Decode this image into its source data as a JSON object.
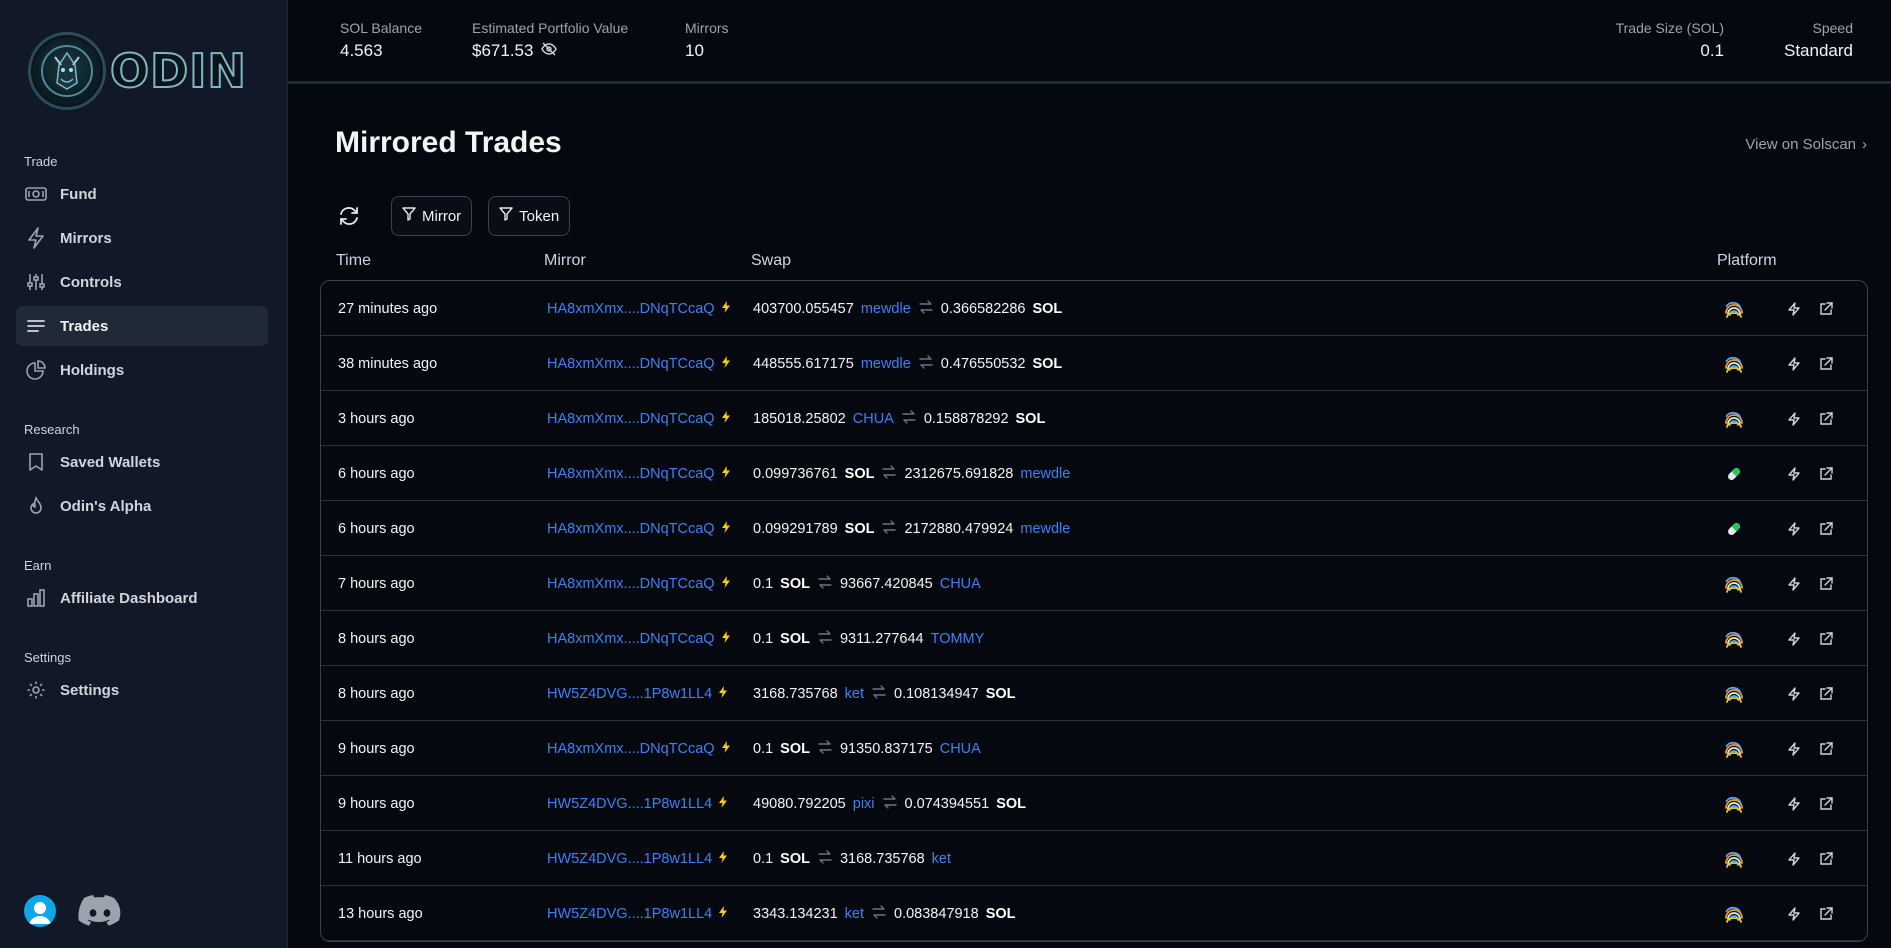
{
  "sidebar": {
    "brand": "ODIN",
    "sections": {
      "trade": "Trade",
      "research": "Research",
      "earn": "Earn",
      "settings": "Settings"
    },
    "items": {
      "fund": "Fund",
      "mirrors": "Mirrors",
      "controls": "Controls",
      "trades": "Trades",
      "holdings": "Holdings",
      "saved_wallets": "Saved Wallets",
      "odins_alpha": "Odin's Alpha",
      "affiliate_dashboard": "Affiliate Dashboard",
      "settings": "Settings"
    },
    "active_item": "trades"
  },
  "header": {
    "sol_balance_label": "SOL Balance",
    "sol_balance": "4.563",
    "portfolio_label": "Estimated Portfolio Value",
    "portfolio_value": "$671.53",
    "mirrors_label": "Mirrors",
    "mirrors_value": "10",
    "trade_size_label": "Trade Size (SOL)",
    "trade_size_value": "0.1",
    "speed_label": "Speed",
    "speed_value": "Standard"
  },
  "main": {
    "title": "Mirrored Trades",
    "view_link": "View on Solscan",
    "filters": {
      "mirror": "Mirror",
      "token": "Token"
    },
    "columns": {
      "time": "Time",
      "mirror": "Mirror",
      "swap": "Swap",
      "platform": "Platform"
    },
    "rows": [
      {
        "time": "27 minutes ago",
        "mirror": "HA8xmXmx....DNqTCcaQ",
        "in_amt": "403700.055457",
        "in_tok": "mewdle",
        "out_amt": "0.366582286",
        "out_tok": "SOL",
        "platform": "rainbow"
      },
      {
        "time": "38 minutes ago",
        "mirror": "HA8xmXmx....DNqTCcaQ",
        "in_amt": "448555.617175",
        "in_tok": "mewdle",
        "out_amt": "0.476550532",
        "out_tok": "SOL",
        "platform": "rainbow"
      },
      {
        "time": "3 hours ago",
        "mirror": "HA8xmXmx....DNqTCcaQ",
        "in_amt": "185018.25802",
        "in_tok": "CHUA",
        "out_amt": "0.158878292",
        "out_tok": "SOL",
        "platform": "rainbow"
      },
      {
        "time": "6 hours ago",
        "mirror": "HA8xmXmx....DNqTCcaQ",
        "in_amt": "0.099736761",
        "in_tok": "SOL",
        "out_amt": "2312675.691828",
        "out_tok": "mewdle",
        "platform": "pill"
      },
      {
        "time": "6 hours ago",
        "mirror": "HA8xmXmx....DNqTCcaQ",
        "in_amt": "0.099291789",
        "in_tok": "SOL",
        "out_amt": "2172880.479924",
        "out_tok": "mewdle",
        "platform": "pill"
      },
      {
        "time": "7 hours ago",
        "mirror": "HA8xmXmx....DNqTCcaQ",
        "in_amt": "0.1",
        "in_tok": "SOL",
        "out_amt": "93667.420845",
        "out_tok": "CHUA",
        "platform": "rainbow"
      },
      {
        "time": "8 hours ago",
        "mirror": "HA8xmXmx....DNqTCcaQ",
        "in_amt": "0.1",
        "in_tok": "SOL",
        "out_amt": "9311.277644",
        "out_tok": "TOMMY",
        "platform": "rainbow"
      },
      {
        "time": "8 hours ago",
        "mirror": "HW5Z4DVG....1P8w1LL4",
        "in_amt": "3168.735768",
        "in_tok": "ket",
        "out_amt": "0.108134947",
        "out_tok": "SOL",
        "platform": "rainbow"
      },
      {
        "time": "9 hours ago",
        "mirror": "HA8xmXmx....DNqTCcaQ",
        "in_amt": "0.1",
        "in_tok": "SOL",
        "out_amt": "91350.837175",
        "out_tok": "CHUA",
        "platform": "rainbow"
      },
      {
        "time": "9 hours ago",
        "mirror": "HW5Z4DVG....1P8w1LL4",
        "in_amt": "49080.792205",
        "in_tok": "pixi",
        "out_amt": "0.074394551",
        "out_tok": "SOL",
        "platform": "rainbow"
      },
      {
        "time": "11 hours ago",
        "mirror": "HW5Z4DVG....1P8w1LL4",
        "in_amt": "0.1",
        "in_tok": "SOL",
        "out_amt": "3168.735768",
        "out_tok": "ket",
        "platform": "rainbow"
      },
      {
        "time": "13 hours ago",
        "mirror": "HW5Z4DVG....1P8w1LL4",
        "in_amt": "3343.134231",
        "in_tok": "ket",
        "out_amt": "0.083847918",
        "out_tok": "SOL",
        "platform": "rainbow"
      }
    ]
  },
  "colors": {
    "accent_link": "#3b82f6",
    "lightning": "#facc15",
    "sidebar_bg": "#111827",
    "page_bg": "#06080f"
  }
}
